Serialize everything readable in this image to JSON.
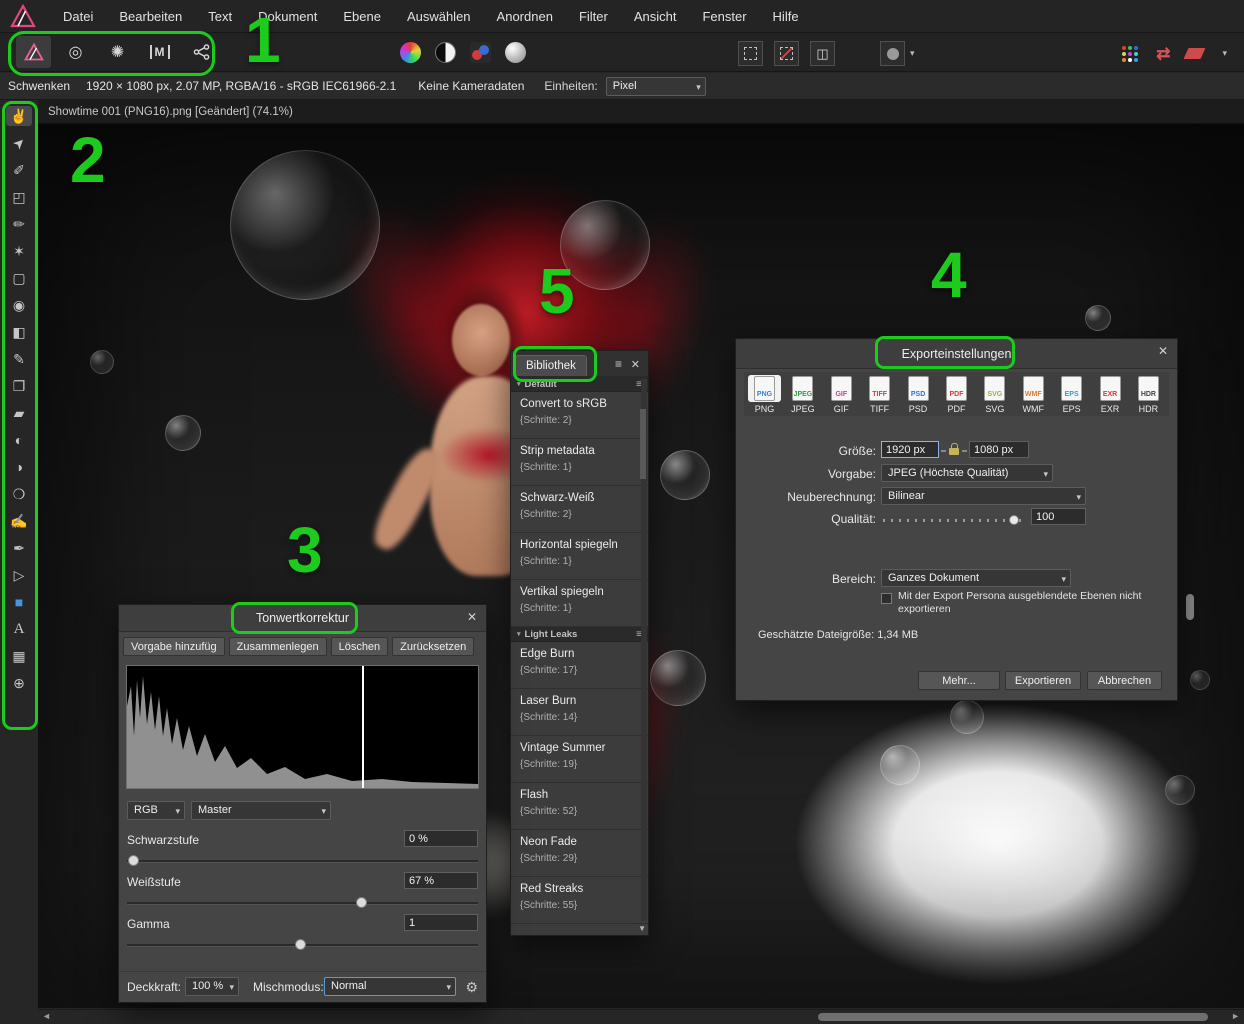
{
  "colors": {
    "annotation_green": "#1ccb1c",
    "accent_blue": "#4596e0"
  },
  "menu_bar": {
    "items": [
      "Datei",
      "Bearbeiten",
      "Text",
      "Dokument",
      "Ebene",
      "Auswählen",
      "Anordnen",
      "Filter",
      "Ansicht",
      "Fenster",
      "Hilfe"
    ]
  },
  "personas": [
    {
      "name": "photo-persona"
    },
    {
      "name": "liquify-persona"
    },
    {
      "name": "develop-persona"
    },
    {
      "name": "tone-mapping-persona",
      "glyph": "M"
    },
    {
      "name": "export-persona"
    }
  ],
  "toolbar_icons": {
    "mid": [
      "color-wheel-icon",
      "contrast-circle-icon",
      "color-dots-icon",
      "sphere-icon"
    ],
    "selection": [
      "new-selection-icon",
      "subtract-selection-icon",
      "intersect-selection-icon"
    ],
    "mask": "quick-mask-icon",
    "right": [
      "grid-dots-icon",
      "swap-arrows-icon",
      "slice-icon"
    ]
  },
  "context_bar": {
    "tool": "Schwenken",
    "document_info": "1920 × 1080 px, 2.07 MP, RGBA/16 - sRGB IEC61966-2.1",
    "camera_info": "Keine Kameradaten",
    "units_label": "Einheiten:",
    "units_value": "Pixel"
  },
  "document_tab": {
    "title": "Showtime 001 (PNG16).png [Geändert] (74.1%)"
  },
  "tools": [
    {
      "name": "view-tool",
      "glyph": "✌"
    },
    {
      "name": "move-tool",
      "glyph": "➤"
    },
    {
      "name": "color-picker-tool",
      "glyph": "✐"
    },
    {
      "name": "crop-tool",
      "glyph": "◰"
    },
    {
      "name": "selection-brush-tool",
      "glyph": "✏"
    },
    {
      "name": "flood-select-tool",
      "glyph": "✶"
    },
    {
      "name": "marquee-tool",
      "glyph": "▢"
    },
    {
      "name": "flood-fill-tool",
      "glyph": "◉"
    },
    {
      "name": "gradient-tool",
      "glyph": "◧"
    },
    {
      "name": "paint-brush-tool",
      "glyph": "✎"
    },
    {
      "name": "clone-tool",
      "glyph": "❐"
    },
    {
      "name": "eraser-tool",
      "glyph": "▰"
    },
    {
      "name": "dodge-tool",
      "glyph": "◐"
    },
    {
      "name": "burn-tool",
      "glyph": "◑"
    },
    {
      "name": "blur-tool",
      "glyph": "❍"
    },
    {
      "name": "smudge-tool",
      "glyph": "✍"
    },
    {
      "name": "pen-tool",
      "glyph": "✒"
    },
    {
      "name": "node-tool",
      "glyph": "▷"
    },
    {
      "name": "rectangle-tool",
      "glyph": "■"
    },
    {
      "name": "text-tool",
      "glyph": "A"
    },
    {
      "name": "mesh-warp-tool",
      "glyph": "▦"
    },
    {
      "name": "zoom-tool",
      "glyph": "⊕"
    }
  ],
  "levels_panel": {
    "title": "Tonwertkorrektur",
    "buttons": [
      "Vorgabe hinzufüg",
      "Zusammenlegen",
      "Löschen",
      "Zurücksetzen"
    ],
    "channel_value": "RGB",
    "master_value": "Master",
    "black_label": "Schwarzstufe",
    "black_value": "0 %",
    "white_label": "Weißstufe",
    "white_value": "67 %",
    "gamma_label": "Gamma",
    "gamma_value": "1",
    "opacity_label": "Deckkraft:",
    "opacity_value": "100 %",
    "blend_label": "Mischmodus:",
    "blend_value": "Normal"
  },
  "library_panel": {
    "tab_label": "Bibliothek",
    "group_default": "Default",
    "group_light_leaks": "Light Leaks",
    "items_default": [
      {
        "name": "Convert to sRGB",
        "steps": "{Schritte: 2}"
      },
      {
        "name": "Strip metadata",
        "steps": "{Schritte: 1}"
      },
      {
        "name": "Schwarz-Weiß",
        "steps": "{Schritte: 2}"
      },
      {
        "name": "Horizontal spiegeln",
        "steps": "{Schritte: 1}"
      },
      {
        "name": "Vertikal spiegeln",
        "steps": "{Schritte: 1}"
      }
    ],
    "items_light_leaks": [
      {
        "name": "Edge Burn",
        "steps": "{Schritte: 17}"
      },
      {
        "name": "Laser Burn",
        "steps": "{Schritte: 14}"
      },
      {
        "name": "Vintage Summer",
        "steps": "{Schritte: 19}"
      },
      {
        "name": "Flash",
        "steps": "{Schritte: 52}"
      },
      {
        "name": "Neon Fade",
        "steps": "{Schritte: 29}"
      },
      {
        "name": "Red Streaks",
        "steps": "{Schritte: 55}"
      }
    ]
  },
  "export_dialog": {
    "title": "Exporteinstellungen",
    "formats": [
      {
        "label": "PNG",
        "color": "#2f7fe0"
      },
      {
        "label": "JPEG",
        "color": "#2ea043"
      },
      {
        "label": "GIF",
        "color": "#c2418e"
      },
      {
        "label": "TIFF",
        "color": "#d23b3b"
      },
      {
        "label": "PSD",
        "color": "#2f6fe0"
      },
      {
        "label": "PDF",
        "color": "#d23b3b"
      },
      {
        "label": "SVG",
        "color": "#9ab52d"
      },
      {
        "label": "WMF",
        "color": "#e07a2f"
      },
      {
        "label": "EPS",
        "color": "#2f9fd2"
      },
      {
        "label": "EXR",
        "color": "#d23b3b"
      },
      {
        "label": "HDR",
        "color": "#444444"
      }
    ],
    "size_label": "Größe:",
    "width_value": "1920 px",
    "height_value": "1080 px",
    "preset_label": "Vorgabe:",
    "preset_value": "JPEG (Höchste Qualität)",
    "resample_label": "Neuberechnung:",
    "resample_value": "Bilinear",
    "quality_label": "Qualität:",
    "quality_value": "100",
    "area_label": "Bereich:",
    "area_value": "Ganzes Dokument",
    "hidden_layers_label": "Mit der Export Persona ausgeblendete Ebenen nicht exportieren",
    "filesize_text": "Geschätzte Dateigröße: 1,34 MB",
    "more_label": "Mehr...",
    "export_label": "Exportieren",
    "cancel_label": "Abbrechen"
  },
  "annotations": {
    "n1": "1",
    "n2": "2",
    "n3": "3",
    "n4": "4",
    "n5": "5"
  }
}
